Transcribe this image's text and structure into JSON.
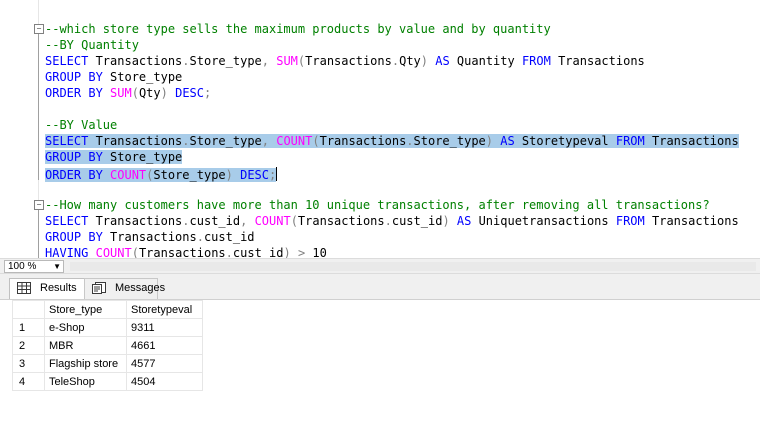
{
  "editor": {
    "lines": [
      [
        {
          "t": "--which store type sells the maximum products by value and by quantity",
          "c": "c"
        }
      ],
      [
        {
          "t": "--BY Quantity",
          "c": "c"
        }
      ],
      [
        {
          "t": "SELECT",
          "c": "k"
        },
        {
          "t": " Transactions",
          "c": "t"
        },
        {
          "t": ".",
          "c": "g"
        },
        {
          "t": "Store_type",
          "c": "t"
        },
        {
          "t": ",",
          "c": "g"
        },
        {
          "t": " ",
          "c": "t"
        },
        {
          "t": "SUM",
          "c": "f"
        },
        {
          "t": "(",
          "c": "g"
        },
        {
          "t": "Transactions",
          "c": "t"
        },
        {
          "t": ".",
          "c": "g"
        },
        {
          "t": "Qty",
          "c": "t"
        },
        {
          "t": ")",
          "c": "g"
        },
        {
          "t": " ",
          "c": "t"
        },
        {
          "t": "AS",
          "c": "k"
        },
        {
          "t": " Quantity ",
          "c": "t"
        },
        {
          "t": "FROM",
          "c": "k"
        },
        {
          "t": " Transactions",
          "c": "t"
        }
      ],
      [
        {
          "t": "GROUP BY",
          "c": "k"
        },
        {
          "t": " Store_type",
          "c": "t"
        }
      ],
      [
        {
          "t": "ORDER BY",
          "c": "k"
        },
        {
          "t": " ",
          "c": "t"
        },
        {
          "t": "SUM",
          "c": "f"
        },
        {
          "t": "(",
          "c": "g"
        },
        {
          "t": "Qty",
          "c": "t"
        },
        {
          "t": ")",
          "c": "g"
        },
        {
          "t": " ",
          "c": "t"
        },
        {
          "t": "DESC",
          "c": "k"
        },
        {
          "t": ";",
          "c": "g"
        }
      ],
      [],
      [
        {
          "t": "--BY Value",
          "c": "c"
        }
      ],
      [
        {
          "t": "SELECT",
          "c": "k"
        },
        {
          "t": " Transactions",
          "c": "t"
        },
        {
          "t": ".",
          "c": "g"
        },
        {
          "t": "Store_type",
          "c": "t"
        },
        {
          "t": ",",
          "c": "g"
        },
        {
          "t": " ",
          "c": "t"
        },
        {
          "t": "COUNT",
          "c": "f"
        },
        {
          "t": "(",
          "c": "g"
        },
        {
          "t": "Transactions",
          "c": "t"
        },
        {
          "t": ".",
          "c": "g"
        },
        {
          "t": "Store_type",
          "c": "t"
        },
        {
          "t": ")",
          "c": "g"
        },
        {
          "t": " ",
          "c": "t"
        },
        {
          "t": "AS",
          "c": "k"
        },
        {
          "t": " Storetypeval ",
          "c": "t"
        },
        {
          "t": "FROM",
          "c": "k"
        },
        {
          "t": " Transactions",
          "c": "t"
        }
      ],
      [
        {
          "t": "GROUP BY",
          "c": "k"
        },
        {
          "t": " Store_type",
          "c": "t"
        }
      ],
      [
        {
          "t": "ORDER BY",
          "c": "k"
        },
        {
          "t": " ",
          "c": "t"
        },
        {
          "t": "COUNT",
          "c": "f"
        },
        {
          "t": "(",
          "c": "g"
        },
        {
          "t": "Store_type",
          "c": "t"
        },
        {
          "t": ")",
          "c": "g"
        },
        {
          "t": " ",
          "c": "t"
        },
        {
          "t": "DESC",
          "c": "k"
        },
        {
          "t": ";",
          "c": "g"
        }
      ],
      [],
      [
        {
          "t": "--How many customers have more than 10 unique transactions, after removing all transactions?",
          "c": "c"
        }
      ],
      [
        {
          "t": "SELECT",
          "c": "k"
        },
        {
          "t": " Transactions",
          "c": "t"
        },
        {
          "t": ".",
          "c": "g"
        },
        {
          "t": "cust_id",
          "c": "t"
        },
        {
          "t": ",",
          "c": "g"
        },
        {
          "t": " ",
          "c": "t"
        },
        {
          "t": "COUNT",
          "c": "f"
        },
        {
          "t": "(",
          "c": "g"
        },
        {
          "t": "Transactions",
          "c": "t"
        },
        {
          "t": ".",
          "c": "g"
        },
        {
          "t": "cust_id",
          "c": "t"
        },
        {
          "t": ")",
          "c": "g"
        },
        {
          "t": " ",
          "c": "t"
        },
        {
          "t": "AS",
          "c": "k"
        },
        {
          "t": " Uniquetransactions ",
          "c": "t"
        },
        {
          "t": "FROM",
          "c": "k"
        },
        {
          "t": " Transactions",
          "c": "t"
        }
      ],
      [
        {
          "t": "GROUP BY",
          "c": "k"
        },
        {
          "t": " Transactions",
          "c": "t"
        },
        {
          "t": ".",
          "c": "g"
        },
        {
          "t": "cust_id",
          "c": "t"
        }
      ],
      [
        {
          "t": "HAVING",
          "c": "k"
        },
        {
          "t": " ",
          "c": "t"
        },
        {
          "t": "COUNT",
          "c": "f"
        },
        {
          "t": "(",
          "c": "g"
        },
        {
          "t": "Transactions",
          "c": "t"
        },
        {
          "t": ".",
          "c": "g"
        },
        {
          "t": "cust_id",
          "c": "t"
        },
        {
          "t": ")",
          "c": "g"
        },
        {
          "t": " ",
          "c": "t"
        },
        {
          "t": ">",
          "c": "g"
        },
        {
          "t": " 10",
          "c": "t"
        }
      ]
    ]
  },
  "zoom": {
    "value": "100 %"
  },
  "tabs": {
    "results_label": "Results",
    "messages_label": "Messages"
  },
  "grid": {
    "columns": [
      "Store_type",
      "Storetypeval"
    ],
    "rows": [
      {
        "n": "1",
        "store_type": "e-Shop",
        "value": "9311"
      },
      {
        "n": "2",
        "store_type": "MBR",
        "value": "4661"
      },
      {
        "n": "3",
        "store_type": "Flagship store",
        "value": "4577"
      },
      {
        "n": "4",
        "store_type": "TeleShop",
        "value": "4504"
      }
    ]
  },
  "colors": {
    "keyword": "#0000ff",
    "function": "#ff00ff",
    "comment": "#008000",
    "operator": "#808080",
    "selection": "#a8cce9"
  }
}
